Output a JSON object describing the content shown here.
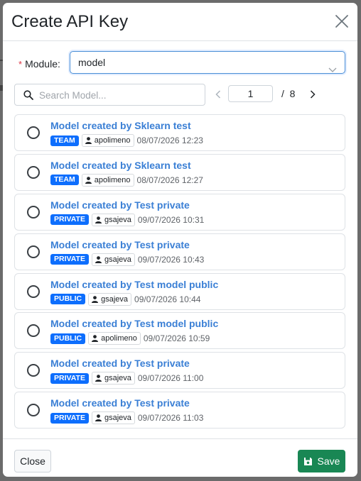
{
  "dialog": {
    "title": "Create API Key"
  },
  "module": {
    "required_mark": "*",
    "label": "Module",
    "colon": ":",
    "selected_value": "model"
  },
  "search": {
    "placeholder": "Search Model...",
    "value": ""
  },
  "pagination": {
    "current_page": "1",
    "total_text": "/  8"
  },
  "items": [
    {
      "title": "Model created by Sklearn test",
      "visibility": "TEAM",
      "user": "apolimeno",
      "date": "08/07/2026 12:23"
    },
    {
      "title": "Model created by Sklearn test",
      "visibility": "TEAM",
      "user": "apolimeno",
      "date": "08/07/2026 12:27"
    },
    {
      "title": "Model created by Test private",
      "visibility": "PRIVATE",
      "user": "gsajeva",
      "date": "09/07/2026 10:31"
    },
    {
      "title": "Model created by Test private",
      "visibility": "PRIVATE",
      "user": "gsajeva",
      "date": "09/07/2026 10:43"
    },
    {
      "title": "Model created by Test model public",
      "visibility": "PUBLIC",
      "user": "gsajeva",
      "date": "09/07/2026 10:44"
    },
    {
      "title": "Model created by Test model public",
      "visibility": "PUBLIC",
      "user": "apolimeno",
      "date": "09/07/2026 10:59"
    },
    {
      "title": "Model created by Test private",
      "visibility": "PRIVATE",
      "user": "gsajeva",
      "date": "09/07/2026 11:00"
    },
    {
      "title": "Model created by Test private",
      "visibility": "PRIVATE",
      "user": "gsajeva",
      "date": "09/07/2026 11:03"
    }
  ],
  "footer": {
    "close_label": "Close",
    "save_label": "Save"
  },
  "colors": {
    "title_link": "#3a7fd5",
    "badge": "#0d6efd",
    "save_button": "#198754"
  },
  "icons": {
    "close": "close-icon",
    "chevron": "chevron-down-icon",
    "search": "search-icon",
    "user": "user-icon",
    "save": "floppy-disk-icon"
  }
}
